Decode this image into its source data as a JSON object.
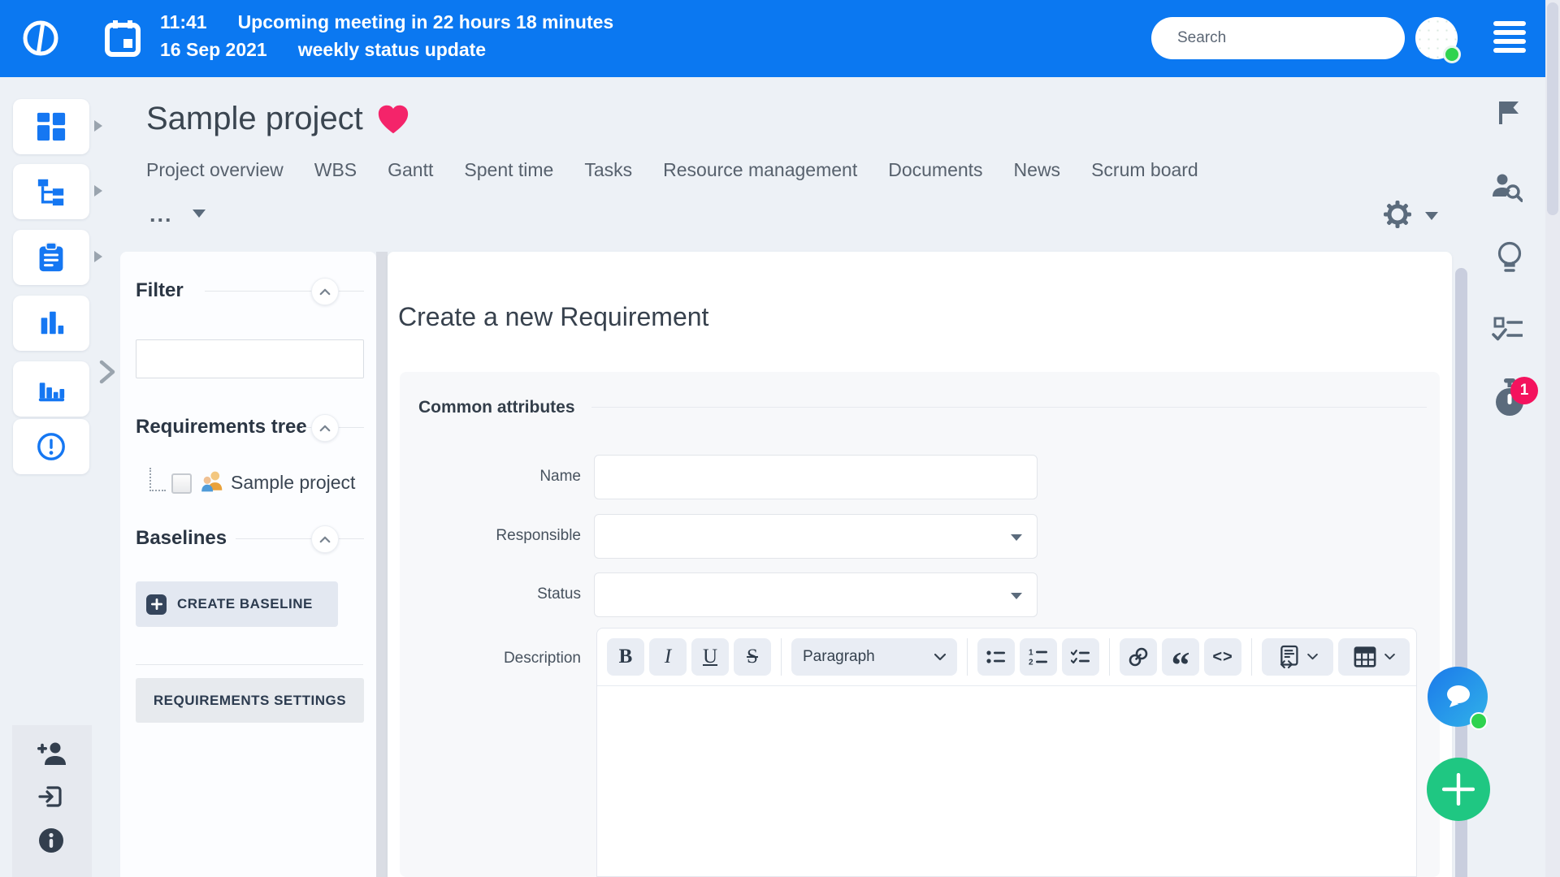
{
  "topbar": {
    "time": "11:41",
    "meeting": "Upcoming meeting in 22 hours 18 minutes",
    "date": "16 Sep 2021",
    "event": "weekly status update",
    "search_placeholder": "Search"
  },
  "header": {
    "title": "Sample project",
    "tabs": [
      "Project overview",
      "WBS",
      "Gantt",
      "Spent time",
      "Tasks",
      "Resource management",
      "Documents",
      "News",
      "Scrum board"
    ],
    "more_label": "..."
  },
  "left_rail": {
    "icons": [
      "dashboard",
      "tree",
      "tasks-clipboard",
      "bar-chart",
      "report-chart",
      "alert"
    ],
    "footer_icons": [
      "add-user",
      "exit",
      "info"
    ]
  },
  "panel": {
    "filter_title": "Filter",
    "filter_value": "",
    "tree_title": "Requirements tree",
    "tree_item_label": "Sample project",
    "baselines_title": "Baselines",
    "create_baseline_label": "CREATE BASELINE",
    "settings_label": "REQUIREMENTS SETTINGS"
  },
  "form": {
    "title": "Create a new Requirement",
    "section_title": "Common attributes",
    "name_label": "Name",
    "name_value": "",
    "responsible_label": "Responsible",
    "responsible_value": "",
    "status_label": "Status",
    "status_value": "",
    "description_label": "Description"
  },
  "editor": {
    "paragraph_label": "Paragraph",
    "bold": "B",
    "italic": "I",
    "underline": "U",
    "strikethrough": "S",
    "quote_glyph": "“",
    "code_glyph": "<>"
  },
  "right_rail": {
    "icons": [
      "flag",
      "user-search",
      "lightbulb",
      "checklist",
      "timer"
    ],
    "timer_badge": "1"
  },
  "colors": {
    "topbar_blue": "#0b78f1",
    "icon_blue": "#1577f2",
    "heart_pink": "#f4246a",
    "badge_pink": "#f4135e",
    "fab_green": "#1fc782",
    "online_green": "#2fd34f"
  }
}
